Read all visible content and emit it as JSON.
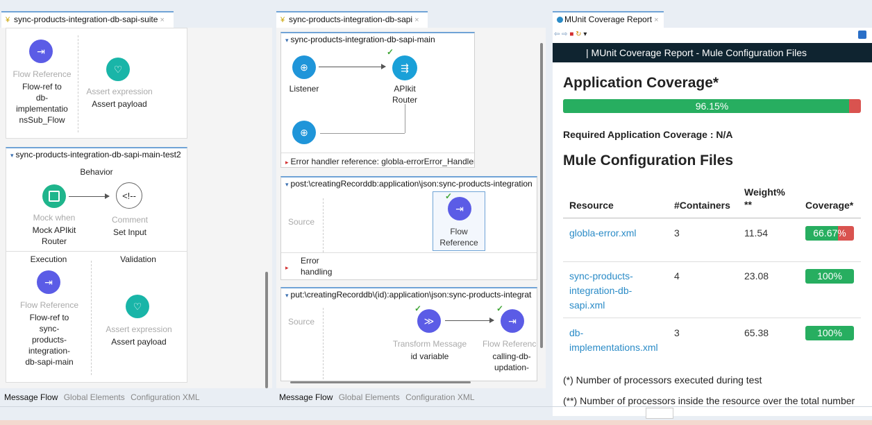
{
  "left_editor": {
    "tab_title": "sync-products-integration-db-sapi-suite",
    "top_flow": {
      "proc1_type": "Flow Reference",
      "proc1_name": "Flow-ref to\ndb-\nimplementatio\nnsSub_Flow",
      "proc2_type": "Assert expression",
      "proc2_name": "Assert payload"
    },
    "test2": {
      "title": "sync-products-integration-db-sapi-main-test2",
      "behavior_label": "Behavior",
      "mock_type": "Mock when",
      "mock_name": "Mock APIkit\nRouter",
      "comment_type": "Comment",
      "comment_name": "Set Input",
      "comment_glyph": "<!--",
      "execution_label": "Execution",
      "validation_label": "Validation",
      "exec_type": "Flow Reference",
      "exec_name": "Flow-ref to\nsync-\nproducts-\nintegration-\ndb-sapi-main",
      "valid_type": "Assert expression",
      "valid_name": "Assert payload"
    },
    "bottom_tabs": [
      "Message Flow",
      "Global Elements",
      "Configuration XML"
    ]
  },
  "middle_editor": {
    "tab_title": "sync-products-integration-db-sapi",
    "main_flow": {
      "title": "sync-products-integration-db-sapi-main",
      "listener": "Listener",
      "router": "APIkit\nRouter",
      "error_ref": "Error handler reference: globla-errorError_Handler"
    },
    "post_flow": {
      "title": "post:\\creatingRecorddb:application\\json:sync-products-integration",
      "source_label": "Source",
      "proc_name": "Flow\nReference",
      "error_label": "Error\nhandling"
    },
    "put_flow": {
      "title": "put:\\creatingRecorddb\\(id):application\\json:sync-products-integrat",
      "source_label": "Source",
      "proc1_type": "Transform Message",
      "proc1_name": "id variable",
      "proc2_type": "Flow Reference",
      "proc2_name": "calling-db-\nupdation-"
    },
    "bottom_tabs": [
      "Message Flow",
      "Global Elements",
      "Configuration XML"
    ]
  },
  "report": {
    "tab_title": "MUnit Coverage Report",
    "header": "| MUnit Coverage Report - Mule Configuration Files",
    "app_coverage_title": "Application Coverage*",
    "app_coverage_value": "96.15%",
    "app_coverage_pct": 96.15,
    "required_label": "Required Application Coverage : N/A",
    "files_title": "Mule Configuration Files",
    "columns": [
      "Resource",
      "#Containers",
      "Weight%\n**",
      "Coverage*"
    ],
    "rows": [
      {
        "resource": "globla-error.xml",
        "containers": "3",
        "weight": "11.54",
        "coverage": "66.67%",
        "pct": 66.67
      },
      {
        "resource": "sync-products-\nintegration-db-\nsapi.xml",
        "containers": "4",
        "weight": "23.08",
        "coverage": "100%",
        "pct": 100
      },
      {
        "resource": "db-\nimplementations.xml",
        "containers": "3",
        "weight": "65.38",
        "coverage": "100%",
        "pct": 100
      }
    ],
    "footnote1": "(*) Number of processors executed during test",
    "footnote2": "(**) Number of processors inside the resource over the total number"
  },
  "colors": {
    "green": "#27ae60",
    "red": "#d9534f",
    "header_bg": "#0f2430",
    "purple": "#5b5ce6",
    "teal": "#19b5a8"
  }
}
